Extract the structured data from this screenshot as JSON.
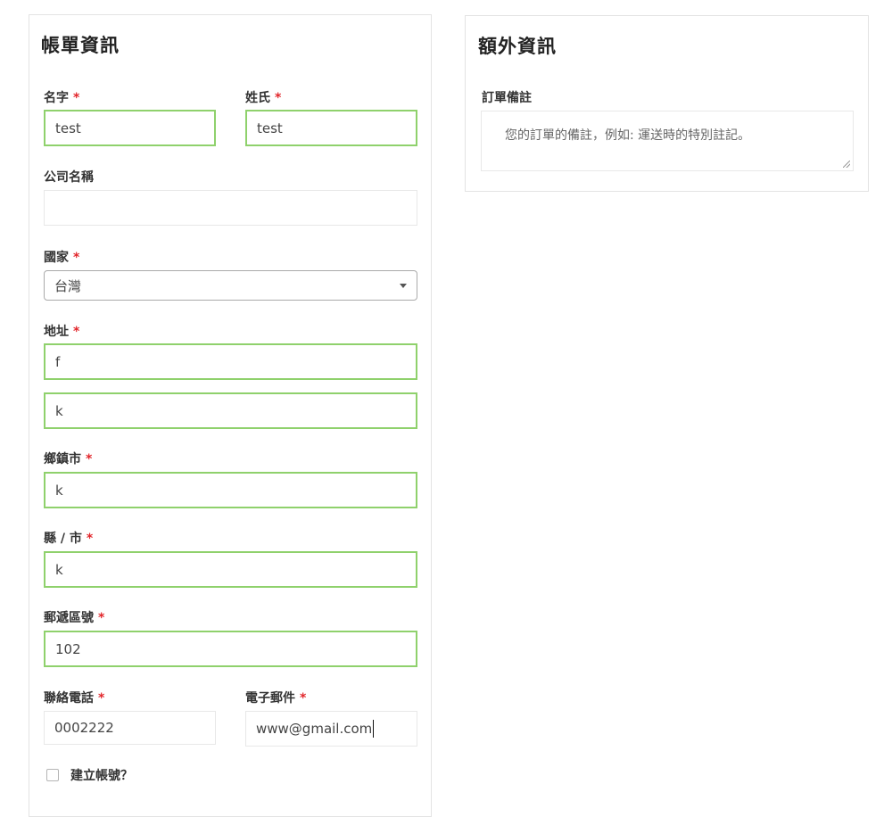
{
  "billing": {
    "title": "帳單資訊",
    "required_mark": "*",
    "first_name": {
      "label": "名字",
      "value": "test"
    },
    "last_name": {
      "label": "姓氏",
      "value": "test"
    },
    "company": {
      "label": "公司名稱",
      "value": ""
    },
    "country": {
      "label": "國家",
      "value": "台灣"
    },
    "address": {
      "label": "地址",
      "line1": "f",
      "line2": "k"
    },
    "town": {
      "label": "鄉鎮市",
      "value": "k"
    },
    "county": {
      "label": "縣 / 市",
      "value": "k"
    },
    "postcode": {
      "label": "郵遞區號",
      "value": "102"
    },
    "phone": {
      "label": "聯絡電話",
      "value": "0002222"
    },
    "email": {
      "label": "電子郵件",
      "value": "www@gmail.com"
    },
    "create_account": {
      "label": "建立帳號？",
      "checked": false
    }
  },
  "additional": {
    "title": "額外資訊",
    "notes": {
      "label": "訂單備註",
      "placeholder": "您的訂單的備註，例如: 運送時的特別註記。"
    }
  },
  "colors": {
    "valid_border": "#8fd16c",
    "required": "#e2262b"
  }
}
